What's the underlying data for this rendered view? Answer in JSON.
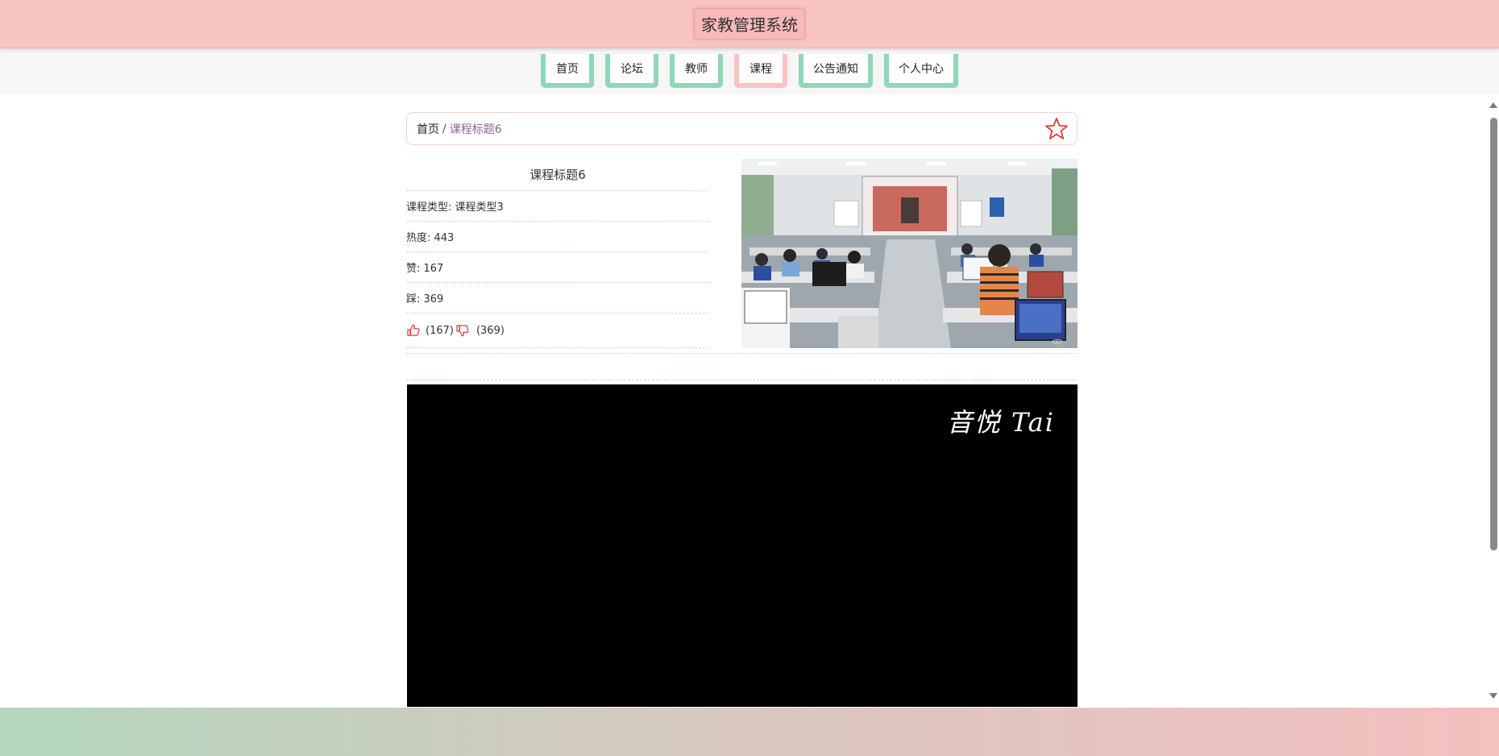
{
  "header": {
    "title": "家教管理系统"
  },
  "nav": {
    "items": [
      {
        "label": "首页",
        "active": false
      },
      {
        "label": "论坛",
        "active": false
      },
      {
        "label": "教师",
        "active": false
      },
      {
        "label": "课程",
        "active": true
      },
      {
        "label": "公告通知",
        "active": false
      },
      {
        "label": "个人中心",
        "active": false
      }
    ]
  },
  "breadcrumb": {
    "home": "首页",
    "separator": "/",
    "current": "课程标题6"
  },
  "course": {
    "title": "课程标题6",
    "type_row": "课程类型: 课程类型3",
    "heat_row": "热度: 443",
    "like_row": "赞: 167",
    "dislike_row": "踩: 369",
    "like_count": "(167)",
    "dislike_count": "(369)"
  },
  "video": {
    "watermark": "音悦 Tai"
  },
  "colors": {
    "header_bg": "#f8c4c4",
    "nav_tab": "#8fd8b6",
    "nav_tab_active": "#f8c4c4",
    "breadcrumb_current": "#8e6790",
    "icon_red": "#e63b3b"
  },
  "icons": {
    "favorite": "star-outline-icon",
    "like": "thumbs-up-icon",
    "dislike": "thumbs-down-icon"
  }
}
